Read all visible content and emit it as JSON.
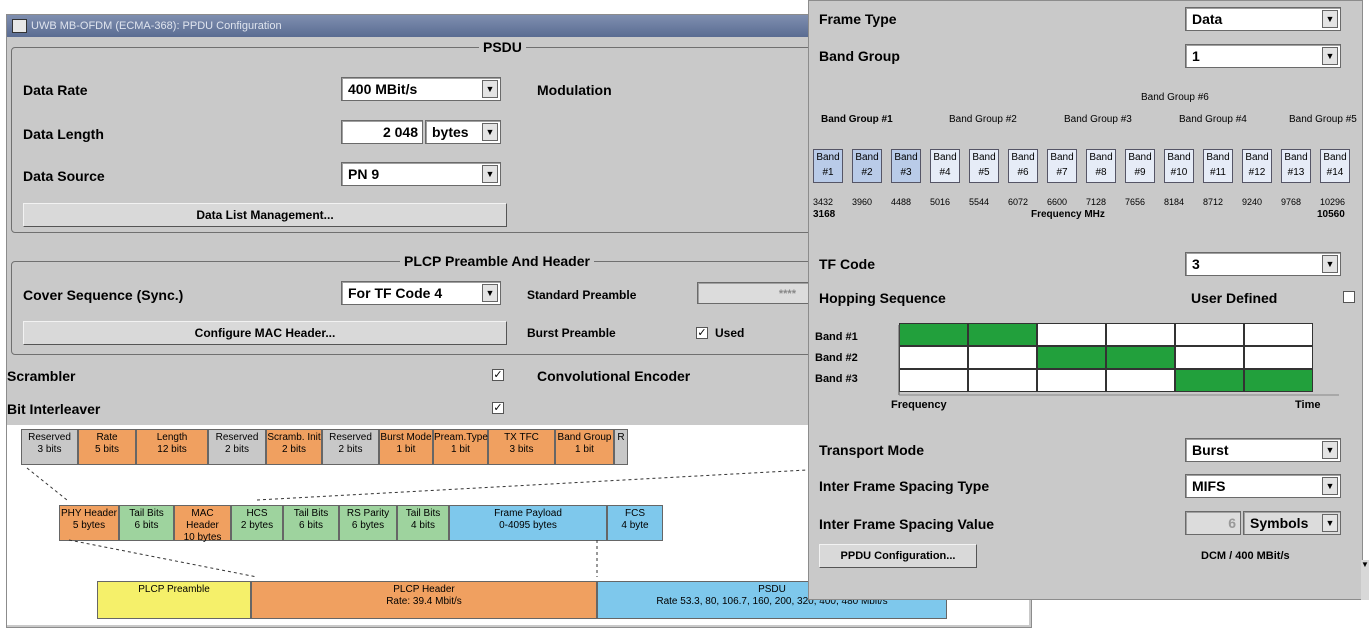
{
  "window": {
    "title": "UWB MB-OFDM (ECMA-368): PPDU Configuration"
  },
  "psdu": {
    "title": "PSDU",
    "data_rate": {
      "label": "Data Rate",
      "value": "400 MBit/s"
    },
    "modulation": {
      "label": "Modulation"
    },
    "data_length": {
      "label": "Data Length",
      "value": "2 048",
      "unit": "bytes"
    },
    "data_source": {
      "label": "Data Source",
      "value": "PN 9"
    },
    "data_list_button": "Data List Management..."
  },
  "plcp": {
    "title": "PLCP Preamble And Header",
    "cover_sequence": {
      "label": "Cover Sequence (Sync.)",
      "value": "For TF Code 4"
    },
    "standard_preamble": {
      "label": "Standard Preamble",
      "value": "****"
    },
    "configure_mac_button": "Configure MAC Header...",
    "burst_preamble": {
      "label": "Burst Preamble",
      "option": "Used",
      "checked": "✓"
    }
  },
  "options": {
    "scrambler": {
      "label": "Scrambler",
      "checked": "✓"
    },
    "conv_encoder": {
      "label": "Convolutional Encoder"
    },
    "bit_interleaver": {
      "label": "Bit Interleaver",
      "checked": "✓"
    }
  },
  "header_fields": [
    {
      "name": "Reserved",
      "size": "3 bits",
      "color": "#c8c8c8"
    },
    {
      "name": "Rate",
      "size": "5 bits",
      "color": "#f0a060"
    },
    {
      "name": "Length",
      "size": "12 bits",
      "color": "#f0a060"
    },
    {
      "name": "Reserved",
      "size": "2 bits",
      "color": "#c8c8c8"
    },
    {
      "name": "Scramb. Init",
      "size": "2 bits",
      "color": "#f0a060"
    },
    {
      "name": "Reserved",
      "size": "2 bits",
      "color": "#c8c8c8"
    },
    {
      "name": "Burst Mode",
      "size": "1 bit",
      "color": "#f0a060"
    },
    {
      "name": "Pream.Type",
      "size": "1 bit",
      "color": "#f0a060"
    },
    {
      "name": "TX TFC",
      "size": "3 bits",
      "color": "#f0a060"
    },
    {
      "name": "Band Group",
      "size": "1 bit",
      "color": "#f0a060"
    },
    {
      "name": "R",
      "size": "",
      "color": "#c8c8c8"
    }
  ],
  "frame_fields": [
    {
      "name": "PHY Header",
      "size": "5 bytes",
      "color": "#f0a060"
    },
    {
      "name": "Tail Bits",
      "size": "6 bits",
      "color": "#9ed39e"
    },
    {
      "name": "MAC Header",
      "size": "10 bytes",
      "color": "#f0a060"
    },
    {
      "name": "HCS",
      "size": "2 bytes",
      "color": "#9ed39e"
    },
    {
      "name": "Tail Bits",
      "size": "6 bits",
      "color": "#9ed39e"
    },
    {
      "name": "RS Parity",
      "size": "6 bytes",
      "color": "#9ed39e"
    },
    {
      "name": "Tail Bits",
      "size": "4 bits",
      "color": "#9ed39e"
    },
    {
      "name": "Frame Payload",
      "size": "0-4095 bytes",
      "color": "#7ec8ec"
    },
    {
      "name": "FCS",
      "size": "4 byte",
      "color": "#7ec8ec"
    }
  ],
  "ppdu_fields": [
    {
      "name": "PLCP Preamble",
      "size": "",
      "color": "#f5f06a"
    },
    {
      "name": "PLCP Header",
      "size": "Rate: 39.4 Mbit/s",
      "color": "#f0a060"
    },
    {
      "name": "PSDU",
      "size": "Rate 53.3, 80, 106.7, 160, 200, 320, 400, 480 Mbit/s",
      "color": "#7ec8ec"
    }
  ],
  "side": {
    "frame_type": {
      "label": "Frame Type",
      "value": "Data"
    },
    "band_group": {
      "label": "Band Group",
      "value": "1"
    },
    "band_group_labels": [
      "Band Group #1",
      "Band Group #2",
      "Band Group #3",
      "Band Group #4",
      "Band Group #5",
      "Band Group #6"
    ],
    "bands": [
      "Band #1",
      "Band #2",
      "Band #3",
      "Band #4",
      "Band #5",
      "Band #6",
      "Band #7",
      "Band #8",
      "Band #9",
      "Band #10",
      "Band #11",
      "Band #12",
      "Band #13",
      "Band #14"
    ],
    "freq_ticks": [
      "3432",
      "3960",
      "4488",
      "5016",
      "5544",
      "6072",
      "6600",
      "7128",
      "7656",
      "8184",
      "8712",
      "9240",
      "9768",
      "10296"
    ],
    "freq_min": "3168",
    "freq_max": "10560",
    "freq_label": "Frequency MHz",
    "tf_code": {
      "label": "TF Code",
      "value": "3"
    },
    "hopping": {
      "label": "Hopping Sequence",
      "user_defined": "User Defined"
    },
    "hop_bands": [
      "Band #1",
      "Band #2",
      "Band #3"
    ],
    "hop_pattern": [
      [
        1,
        1,
        0,
        0,
        0,
        0
      ],
      [
        0,
        0,
        1,
        1,
        0,
        0
      ],
      [
        0,
        0,
        0,
        0,
        1,
        1
      ]
    ],
    "hop_color": "#22a03c",
    "hop_axis_x": "Frequency",
    "hop_axis_t": "Time",
    "transport_mode": {
      "label": "Transport Mode",
      "value": "Burst"
    },
    "ifs_type": {
      "label": "Inter Frame Spacing Type",
      "value": "MIFS"
    },
    "ifs_value": {
      "label": "Inter Frame Spacing Value",
      "value": "6",
      "unit": "Symbols"
    },
    "ppdu_button": "PPDU Configuration...",
    "status": "DCM  /  400 MBit/s"
  }
}
